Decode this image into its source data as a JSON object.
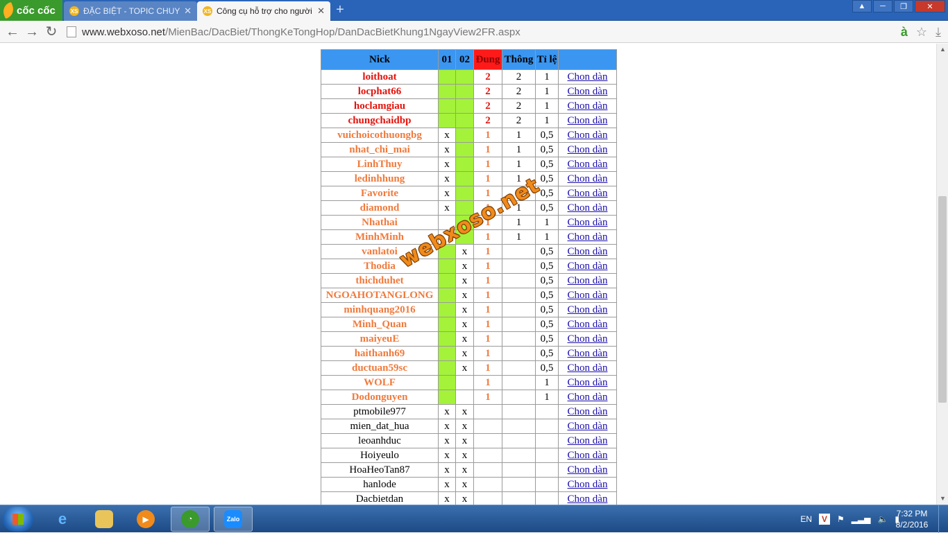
{
  "browser": {
    "logo_text": "cốc cốc",
    "tabs": [
      {
        "icon": "XS",
        "title": "ĐẶC BIỆT - TOPIC CHUYÊN",
        "active": false
      },
      {
        "icon": "XS",
        "title": "Công cụ hỗ trợ cho người",
        "active": true
      }
    ],
    "url_domain": "www.webxoso.net",
    "url_path": "/MienBac/DacBiet/ThongKeTongHop/DanDacBietKhung1NgayView2FR.aspx"
  },
  "table": {
    "headers": {
      "nick": "Nick",
      "c01": "01",
      "c02": "02",
      "dung": "Đung",
      "thong": "Thông",
      "tile": "Tỉ lệ",
      "chon": ""
    },
    "link_label": "Chon dàn",
    "rows": [
      {
        "nick": "loithoat",
        "c01": "",
        "c02": "",
        "g01": true,
        "g02": true,
        "dung": "2",
        "thong": "2",
        "tile": "1",
        "tier": 2
      },
      {
        "nick": "locphat66",
        "c01": "",
        "c02": "",
        "g01": true,
        "g02": true,
        "dung": "2",
        "thong": "2",
        "tile": "1",
        "tier": 2
      },
      {
        "nick": "hoclamgiau",
        "c01": "",
        "c02": "",
        "g01": true,
        "g02": true,
        "dung": "2",
        "thong": "2",
        "tile": "1",
        "tier": 2
      },
      {
        "nick": "chungchaidbp",
        "c01": "",
        "c02": "",
        "g01": true,
        "g02": true,
        "dung": "2",
        "thong": "2",
        "tile": "1",
        "tier": 2
      },
      {
        "nick": "vuichoicothuongbg",
        "c01": "x",
        "c02": "",
        "g01": false,
        "g02": true,
        "dung": "1",
        "thong": "1",
        "tile": "0,5",
        "tier": 1
      },
      {
        "nick": "nhat_chi_mai",
        "c01": "x",
        "c02": "",
        "g01": false,
        "g02": true,
        "dung": "1",
        "thong": "1",
        "tile": "0,5",
        "tier": 1
      },
      {
        "nick": "LinhThuy",
        "c01": "x",
        "c02": "",
        "g01": false,
        "g02": true,
        "dung": "1",
        "thong": "1",
        "tile": "0,5",
        "tier": 1
      },
      {
        "nick": "ledinhhung",
        "c01": "x",
        "c02": "",
        "g01": false,
        "g02": true,
        "dung": "1",
        "thong": "1",
        "tile": "0,5",
        "tier": 1
      },
      {
        "nick": "Favorite",
        "c01": "x",
        "c02": "",
        "g01": false,
        "g02": true,
        "dung": "1",
        "thong": "1",
        "tile": "0,5",
        "tier": 1
      },
      {
        "nick": "diamond",
        "c01": "x",
        "c02": "",
        "g01": false,
        "g02": true,
        "dung": "1",
        "thong": "1",
        "tile": "0,5",
        "tier": 1
      },
      {
        "nick": "Nhathai",
        "c01": "",
        "c02": "",
        "g01": false,
        "g02": true,
        "dung": "1",
        "thong": "1",
        "tile": "1",
        "tier": 1
      },
      {
        "nick": "MinhMinh",
        "c01": "",
        "c02": "",
        "g01": false,
        "g02": true,
        "dung": "1",
        "thong": "1",
        "tile": "1",
        "tier": 1
      },
      {
        "nick": "vanlatoi",
        "c01": "",
        "c02": "x",
        "g01": true,
        "g02": false,
        "dung": "1",
        "thong": "",
        "tile": "0,5",
        "tier": 1
      },
      {
        "nick": "Thodia",
        "c01": "",
        "c02": "x",
        "g01": true,
        "g02": false,
        "dung": "1",
        "thong": "",
        "tile": "0,5",
        "tier": 1
      },
      {
        "nick": "thichduhet",
        "c01": "",
        "c02": "x",
        "g01": true,
        "g02": false,
        "dung": "1",
        "thong": "",
        "tile": "0,5",
        "tier": 1
      },
      {
        "nick": "NGOAHOTANGLONG",
        "c01": "",
        "c02": "x",
        "g01": true,
        "g02": false,
        "dung": "1",
        "thong": "",
        "tile": "0,5",
        "tier": 1
      },
      {
        "nick": "minhquang2016",
        "c01": "",
        "c02": "x",
        "g01": true,
        "g02": false,
        "dung": "1",
        "thong": "",
        "tile": "0,5",
        "tier": 1
      },
      {
        "nick": "Minh_Quan",
        "c01": "",
        "c02": "x",
        "g01": true,
        "g02": false,
        "dung": "1",
        "thong": "",
        "tile": "0,5",
        "tier": 1
      },
      {
        "nick": "maiyeuE",
        "c01": "",
        "c02": "x",
        "g01": true,
        "g02": false,
        "dung": "1",
        "thong": "",
        "tile": "0,5",
        "tier": 1
      },
      {
        "nick": "haithanh69",
        "c01": "",
        "c02": "x",
        "g01": true,
        "g02": false,
        "dung": "1",
        "thong": "",
        "tile": "0,5",
        "tier": 1
      },
      {
        "nick": "ductuan59sc",
        "c01": "",
        "c02": "x",
        "g01": true,
        "g02": false,
        "dung": "1",
        "thong": "",
        "tile": "0,5",
        "tier": 1
      },
      {
        "nick": "WOLF",
        "c01": "",
        "c02": "",
        "g01": true,
        "g02": false,
        "dung": "1",
        "thong": "",
        "tile": "1",
        "tier": 1
      },
      {
        "nick": "Dodonguyen",
        "c01": "",
        "c02": "",
        "g01": true,
        "g02": false,
        "dung": "1",
        "thong": "",
        "tile": "1",
        "tier": 1
      },
      {
        "nick": "ptmobile977",
        "c01": "x",
        "c02": "x",
        "g01": false,
        "g02": false,
        "dung": "",
        "thong": "",
        "tile": "",
        "tier": 0
      },
      {
        "nick": "mien_dat_hua",
        "c01": "x",
        "c02": "x",
        "g01": false,
        "g02": false,
        "dung": "",
        "thong": "",
        "tile": "",
        "tier": 0
      },
      {
        "nick": "leoanhduc",
        "c01": "x",
        "c02": "x",
        "g01": false,
        "g02": false,
        "dung": "",
        "thong": "",
        "tile": "",
        "tier": 0
      },
      {
        "nick": "Hoiyeulo",
        "c01": "x",
        "c02": "x",
        "g01": false,
        "g02": false,
        "dung": "",
        "thong": "",
        "tile": "",
        "tier": 0
      },
      {
        "nick": "HoaHeoTan87",
        "c01": "x",
        "c02": "x",
        "g01": false,
        "g02": false,
        "dung": "",
        "thong": "",
        "tile": "",
        "tier": 0
      },
      {
        "nick": "hanlode",
        "c01": "x",
        "c02": "x",
        "g01": false,
        "g02": false,
        "dung": "",
        "thong": "",
        "tile": "",
        "tier": 0
      },
      {
        "nick": "Dacbietdan",
        "c01": "x",
        "c02": "x",
        "g01": false,
        "g02": false,
        "dung": "",
        "thong": "",
        "tile": "",
        "tier": 0
      }
    ]
  },
  "watermark": "webxoso.net",
  "taskbar": {
    "language": "EN",
    "zalo_label": "Zalo",
    "time": "7:32 PM",
    "date": "8/2/2016"
  },
  "colors": {
    "header_blue": "#3a96f0",
    "header_red": "#ff1a1a",
    "cell_green": "#a4f23a",
    "tier2_text": "#e3120b",
    "tier1_text": "#f07a3c",
    "link": "#1a0dab"
  }
}
